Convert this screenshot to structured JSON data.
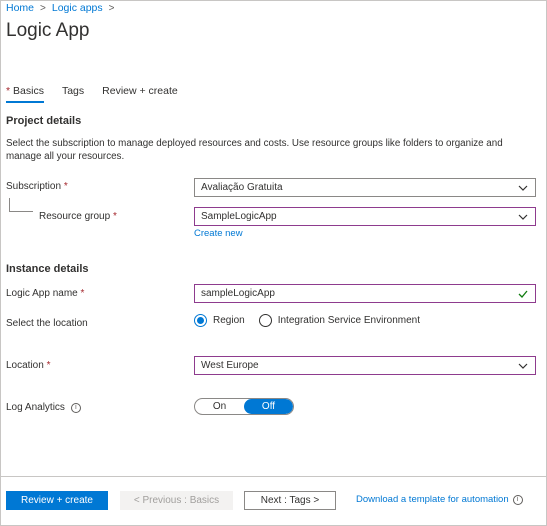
{
  "breadcrumb": {
    "home": "Home",
    "logic_apps": "Logic apps",
    "separator": ">"
  },
  "page_title": "Logic App",
  "tabs": [
    {
      "label": "Basics",
      "required": "*",
      "active": true
    },
    {
      "label": "Tags"
    },
    {
      "label": "Review + create"
    }
  ],
  "project_details": {
    "heading": "Project details",
    "description": "Select the subscription to manage deployed resources and costs. Use resource groups like folders to organize and manage all your resources.",
    "subscription_label": "Subscription",
    "subscription_value": "Avaliação Gratuita",
    "resource_group_label": "Resource group",
    "resource_group_value": "SampleLogicApp",
    "create_new": "Create new"
  },
  "instance_details": {
    "heading": "Instance details",
    "name_label": "Logic App name",
    "name_value": "sampleLogicApp",
    "location_select_label": "Select the location",
    "radio_region": "Region",
    "radio_ise": "Integration Service Environment",
    "location_label": "Location",
    "location_value": "West Europe",
    "log_analytics_label": "Log Analytics",
    "toggle_on": "On",
    "toggle_off": "Off"
  },
  "required_mark": "*",
  "footer": {
    "review_create": "Review + create",
    "previous": "< Previous : Basics",
    "next": "Next : Tags >",
    "download": "Download a template for automation"
  },
  "colors": {
    "accent": "#0078d4",
    "required": "#a4262c",
    "valid": "#107c10",
    "focus_border": "#8e3b8e"
  }
}
